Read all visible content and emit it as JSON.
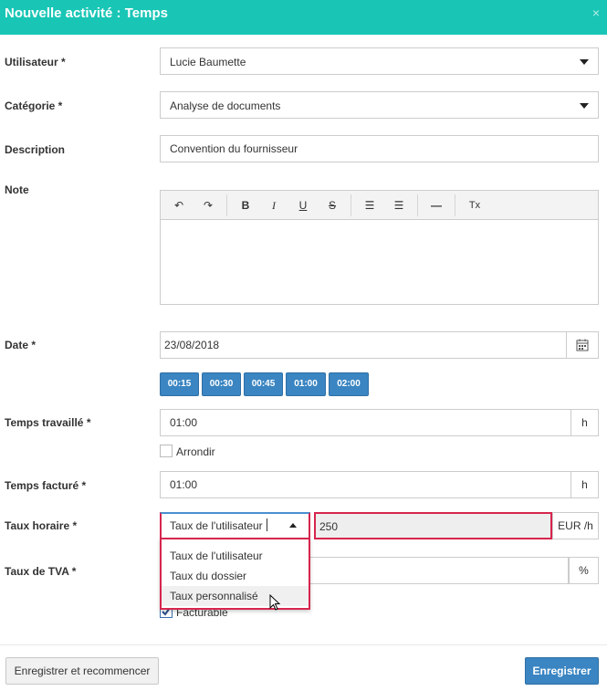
{
  "dialog": {
    "title": "Nouvelle activité : Temps",
    "close_icon": "×"
  },
  "colors": {
    "header": "#19c6b6",
    "primary": "#3a85c2",
    "highlight": "#d6254e"
  },
  "form": {
    "user": {
      "label": "Utilisateur *",
      "value": "Lucie Baumette"
    },
    "category": {
      "label": "Catégorie *",
      "value": "Analyse de documents"
    },
    "description": {
      "label": "Description",
      "value": "Convention du fournisseur"
    },
    "note": {
      "label": "Note",
      "toolbar": {
        "undo": "↶",
        "redo": "↷",
        "bold": "B",
        "italic": "I",
        "underline": "U",
        "strike": "S",
        "bullet_list": "☰",
        "numbered_list": "☰",
        "hr": "—",
        "remove_format": "Tx"
      }
    },
    "date": {
      "label": "Date *",
      "value": "23/08/2018",
      "quick_buttons": [
        "00:15",
        "00:30",
        "00:45",
        "01:00",
        "02:00"
      ]
    },
    "time_worked": {
      "label": "Temps travaillé *",
      "value": "01:00",
      "unit": "h",
      "round_label": "Arrondir"
    },
    "time_billed": {
      "label": "Temps facturé *",
      "value": "01:00",
      "unit": "h"
    },
    "hourly_rate": {
      "label": "Taux horaire *",
      "selected": "Taux de l'utilisateur",
      "value": "250",
      "unit": "EUR /h",
      "options": [
        "Taux de l'utilisateur",
        "Taux du dossier",
        "Taux personnalisé"
      ]
    },
    "vat": {
      "label": "Taux de TVA *",
      "unit": "%"
    },
    "billable": {
      "label": "Facturable",
      "checked": true
    }
  },
  "footer": {
    "save_restart": "Enregistrer et recommencer",
    "save": "Enregistrer"
  }
}
